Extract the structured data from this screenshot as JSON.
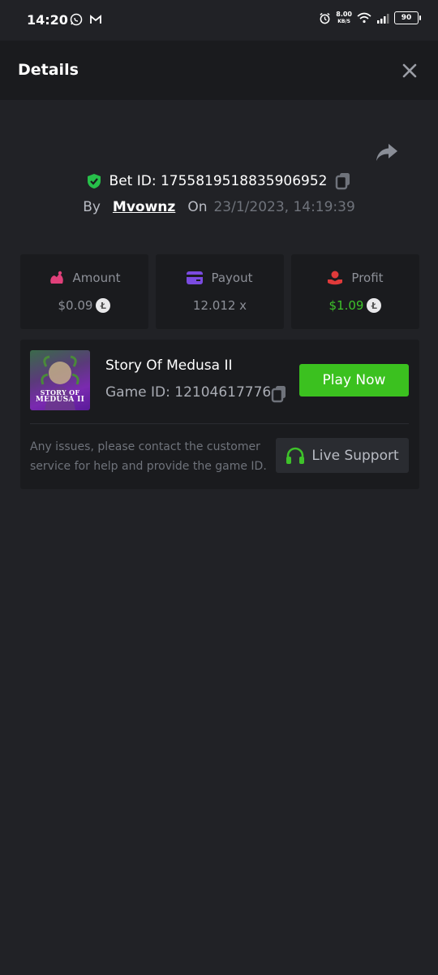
{
  "status_bar": {
    "time": "14:20",
    "speed_value": "8.00",
    "speed_unit": "KB/S",
    "battery": "90"
  },
  "header": {
    "title": "Details"
  },
  "bet": {
    "id_label": "Bet ID: 1755819518835906952",
    "by_label": "By",
    "user": "Mvownz",
    "on_label": "On",
    "date": "23/1/2023, 14:19:39"
  },
  "stats": {
    "amount": {
      "label": "Amount",
      "value": "$0.09",
      "icon_color": "#e0407a"
    },
    "payout": {
      "label": "Payout",
      "value": "12.012 x",
      "icon_color": "#7a4be0"
    },
    "profit": {
      "label": "Profit",
      "value": "$1.09",
      "icon_color": "#e03a3a",
      "value_color": "#3ec22a"
    }
  },
  "game": {
    "thumb_text_line1": "STORY OF",
    "thumb_text_line2": "MEDUSA II",
    "name": "Story Of Medusa II",
    "id_label": "Game ID: 12104617776",
    "play_label": "Play Now",
    "issue_text": "Any issues, please contact the customer service for help and provide the game ID.",
    "support_label": "Live Support"
  },
  "colors": {
    "background": "#212226",
    "panel": "#1a1b1e",
    "accent_green": "#3bc11f"
  }
}
